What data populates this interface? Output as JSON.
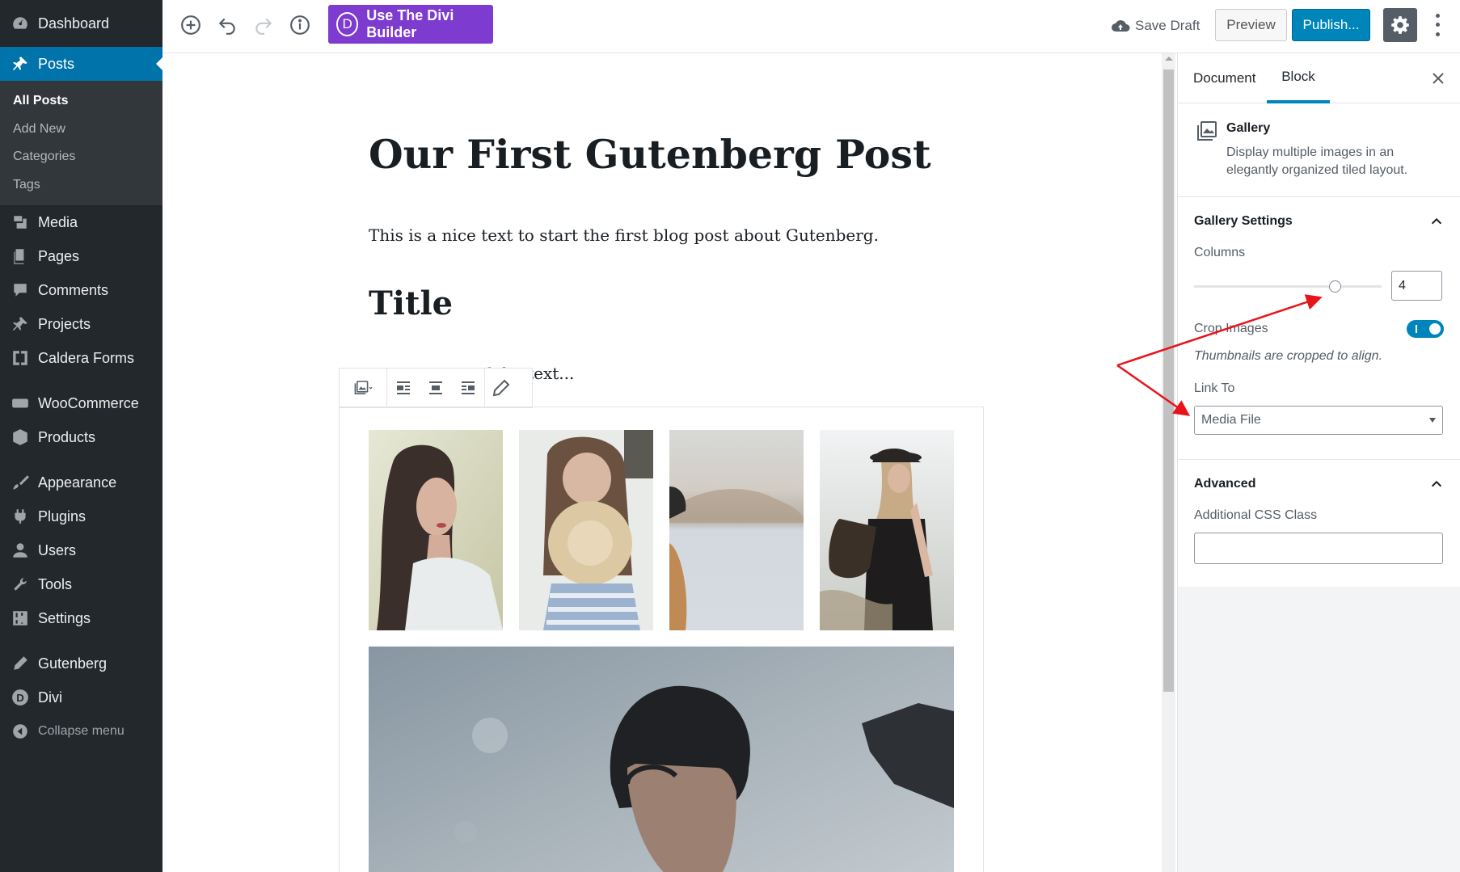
{
  "admin_menu": {
    "items": [
      {
        "label": "Dashboard",
        "icon": "dashboard-icon"
      },
      {
        "label": "Posts",
        "icon": "pin-icon"
      },
      {
        "label": "Media",
        "icon": "media-icon"
      },
      {
        "label": "Pages",
        "icon": "pages-icon"
      },
      {
        "label": "Comments",
        "icon": "comments-icon"
      },
      {
        "label": "Projects",
        "icon": "pin-icon"
      },
      {
        "label": "Caldera Forms",
        "icon": "caldera-icon"
      },
      {
        "label": "WooCommerce",
        "icon": "woo-icon"
      },
      {
        "label": "Products",
        "icon": "products-icon"
      },
      {
        "label": "Appearance",
        "icon": "brush-icon"
      },
      {
        "label": "Plugins",
        "icon": "plugin-icon"
      },
      {
        "label": "Users",
        "icon": "user-icon"
      },
      {
        "label": "Tools",
        "icon": "wrench-icon"
      },
      {
        "label": "Settings",
        "icon": "settings-icon"
      },
      {
        "label": "Gutenberg",
        "icon": "pencil-icon"
      },
      {
        "label": "Divi",
        "icon": "divi-icon"
      },
      {
        "label": "Collapse menu",
        "icon": "collapse-icon"
      }
    ],
    "posts_submenu": [
      "All Posts",
      "Add New",
      "Categories",
      "Tags"
    ]
  },
  "header": {
    "divi_button": "Use The Divi Builder",
    "divi_letter": "D",
    "save_draft": "Save Draft",
    "preview": "Preview",
    "publish": "Publish..."
  },
  "editor": {
    "title": "Our First Gutenberg Post",
    "paragraph1": "This is a nice text to start the first blog post about Gutenberg.",
    "heading": "Title",
    "paragraph2": "of the text..."
  },
  "sidebar": {
    "tabs": [
      "Document",
      "Block"
    ],
    "active_tab": "Block",
    "block": {
      "name": "Gallery",
      "description": "Display multiple images in an elegantly organized tiled layout."
    },
    "gallery_settings": {
      "title": "Gallery Settings",
      "columns_label": "Columns",
      "columns_value": "4",
      "columns_min": 1,
      "columns_max": 5,
      "crop_label": "Crop Images",
      "crop_enabled": true,
      "crop_help": "Thumbnails are cropped to align.",
      "link_to_label": "Link To",
      "link_to_value": "Media File"
    },
    "advanced": {
      "title": "Advanced",
      "css_class_label": "Additional CSS Class",
      "css_class_value": ""
    }
  },
  "colors": {
    "admin_bg": "#23282d",
    "admin_active": "#0073aa",
    "divi_purple": "#7e3bd0",
    "publish_blue": "#0085ba",
    "annotation_red": "#e8141b"
  }
}
